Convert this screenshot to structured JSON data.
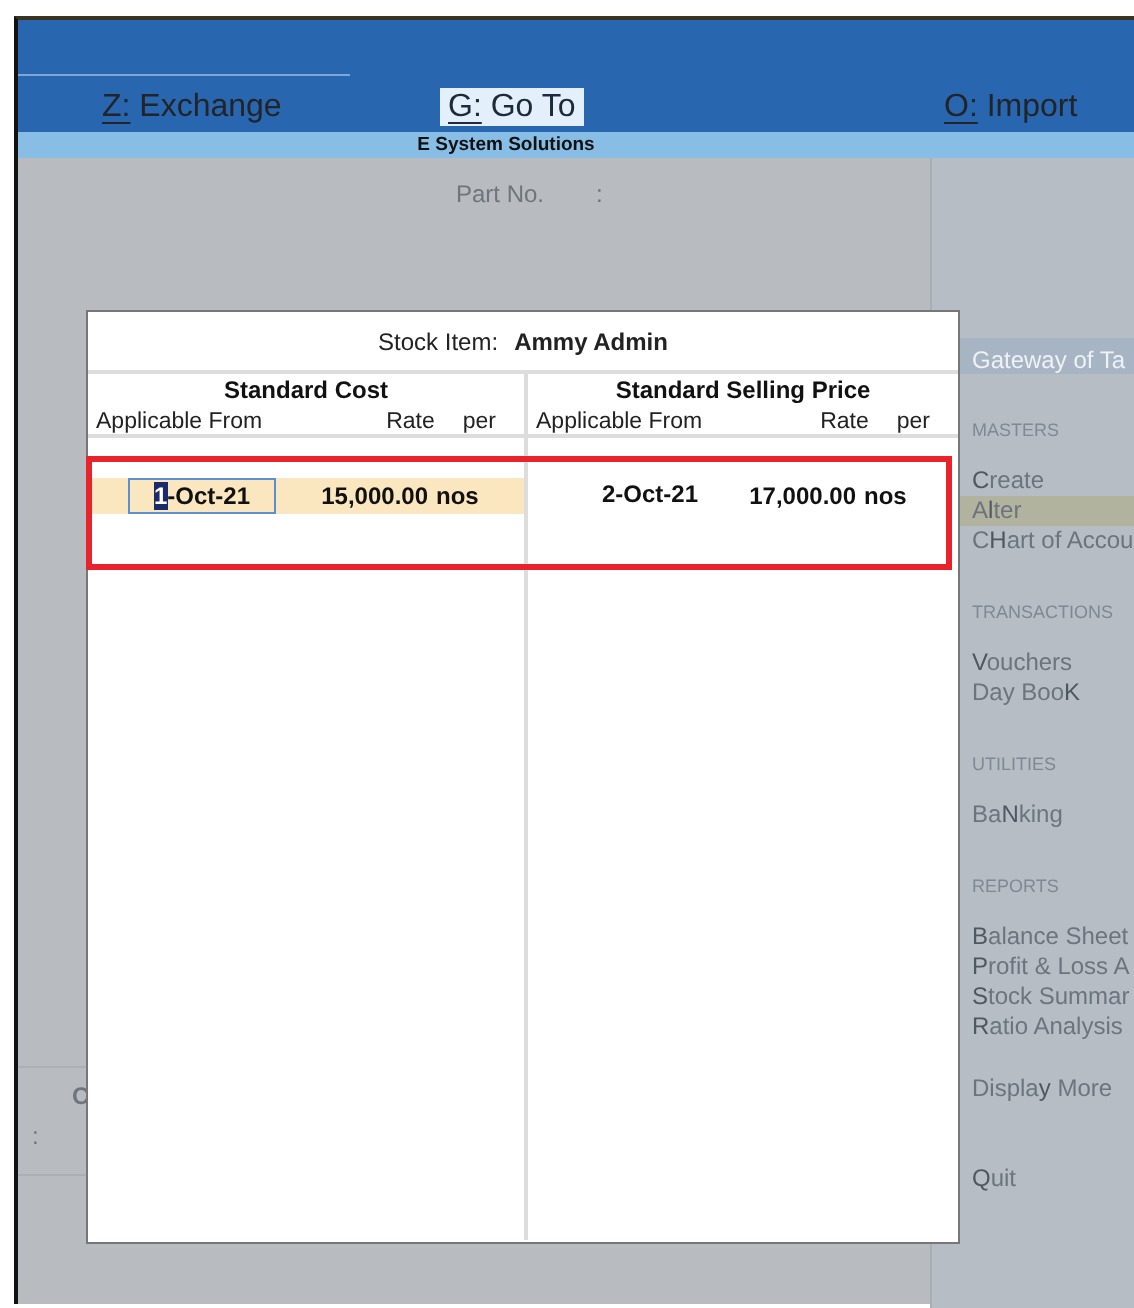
{
  "menu": [
    {
      "key": "Z:",
      "label": "Exchange",
      "selected": false
    },
    {
      "key": "G:",
      "label": "Go To",
      "selected": true
    },
    {
      "key": "O:",
      "label": "Import",
      "selected": false
    }
  ],
  "company": "E System Solutions",
  "background": {
    "field_label": "Part No.",
    "field_sep": ":",
    "cut_letter": "C",
    "cut_sep": ":"
  },
  "gateway": {
    "title": "Gateway of Ta",
    "groups": [
      {
        "heading": "MASTERS",
        "items": [
          {
            "label": "**C**reate",
            "selected": false
          },
          {
            "label": "A**l**ter",
            "selected": true
          },
          {
            "label": "C**H**art of Accou",
            "selected": false
          }
        ]
      },
      {
        "heading": "TRANSACTIONS",
        "items": [
          {
            "label": "**V**ouchers",
            "selected": false
          },
          {
            "label": "Day Boo**K**",
            "selected": false
          }
        ]
      },
      {
        "heading": "UTILITIES",
        "items": [
          {
            "label": "Ba**N**king",
            "selected": false
          }
        ]
      },
      {
        "heading": "REPORTS",
        "items": [
          {
            "label": "**B**alance Sheet",
            "selected": false
          },
          {
            "label": "**P**rofit & Loss A",
            "selected": false
          },
          {
            "label": "**S**tock Summar",
            "selected": false
          },
          {
            "label": "**R**atio Analysis",
            "selected": false
          }
        ]
      },
      {
        "items": [
          {
            "label": "Displa**y** More",
            "selected": false
          }
        ]
      },
      {
        "items": [
          {
            "label": "**Q**uit",
            "selected": false
          }
        ]
      }
    ]
  },
  "dialog": {
    "title_label": "Stock Item:",
    "title_value": "Ammy Admin",
    "sections": [
      {
        "heading": "Standard Cost",
        "columns": [
          "Applicable From",
          "Rate",
          "per"
        ],
        "rows": [
          {
            "date": "1-Oct-21",
            "rate": "15,000.00",
            "per": "nos",
            "focused": true
          }
        ]
      },
      {
        "heading": "Standard Selling Price",
        "columns": [
          "Applicable From",
          "Rate",
          "per"
        ],
        "rows": [
          {
            "date": "2-Oct-21",
            "rate": "17,000.00",
            "per": "nos",
            "focused": false
          }
        ]
      }
    ]
  }
}
